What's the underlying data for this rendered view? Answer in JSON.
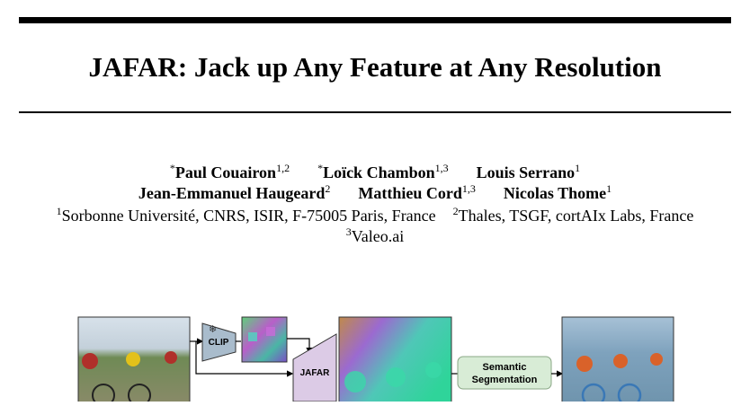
{
  "title": "JAFAR: Jack up Any Feature at Any Resolution",
  "authors_line1": [
    {
      "mark": "*",
      "name": "Paul Couairon",
      "sup": "1,2"
    },
    {
      "mark": "*",
      "name": "Loïck Chambon",
      "sup": "1,3"
    },
    {
      "mark": "",
      "name": "Louis Serrano",
      "sup": "1"
    }
  ],
  "authors_line2": [
    {
      "name": "Jean-Emmanuel Haugeard",
      "sup": "2"
    },
    {
      "name": "Matthieu Cord",
      "sup": "1,3"
    },
    {
      "name": "Nicolas Thome",
      "sup": "1"
    }
  ],
  "affiliations": [
    {
      "sup": "1",
      "text": "Sorbonne Université, CNRS, ISIR, F-75005 Paris, France"
    },
    {
      "sup": "2",
      "text": "Thales, TSGF, cortAIx Labs, France"
    },
    {
      "sup": "3",
      "text": "Valeo.ai"
    }
  ],
  "figure": {
    "clip_label": "CLIP",
    "jafar_label": "JAFAR",
    "task_label_line1": "Semantic",
    "task_label_line2": "Segmentation",
    "frozen_icon": "snowflake-icon"
  }
}
